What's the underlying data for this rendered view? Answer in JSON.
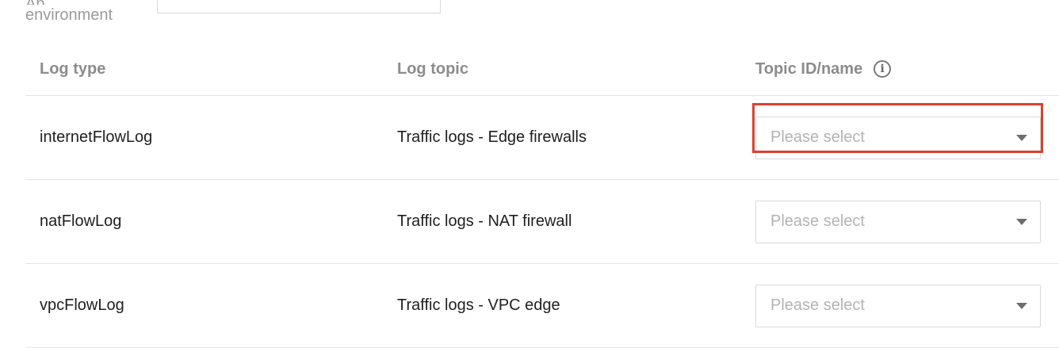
{
  "form": {
    "env_label_line1": "Ap",
    "env_label_line2": "environment",
    "env_input_value": ""
  },
  "table": {
    "columns": [
      "Log type",
      "Log topic",
      "Topic ID/name"
    ],
    "info_icon": "info-icon",
    "rows": [
      {
        "log_type": "internetFlowLog",
        "log_topic": "Traffic logs - Edge firewalls",
        "topic_placeholder": "Please select"
      },
      {
        "log_type": "natFlowLog",
        "log_topic": "Traffic logs - NAT firewall",
        "topic_placeholder": "Please select"
      },
      {
        "log_type": "vpcFlowLog",
        "log_topic": "Traffic logs - VPC edge",
        "topic_placeholder": "Please select"
      }
    ]
  },
  "colors": {
    "highlight": "#e03e2d",
    "header_text": "#8c8c8c",
    "placeholder_text": "#b3b3b3"
  }
}
